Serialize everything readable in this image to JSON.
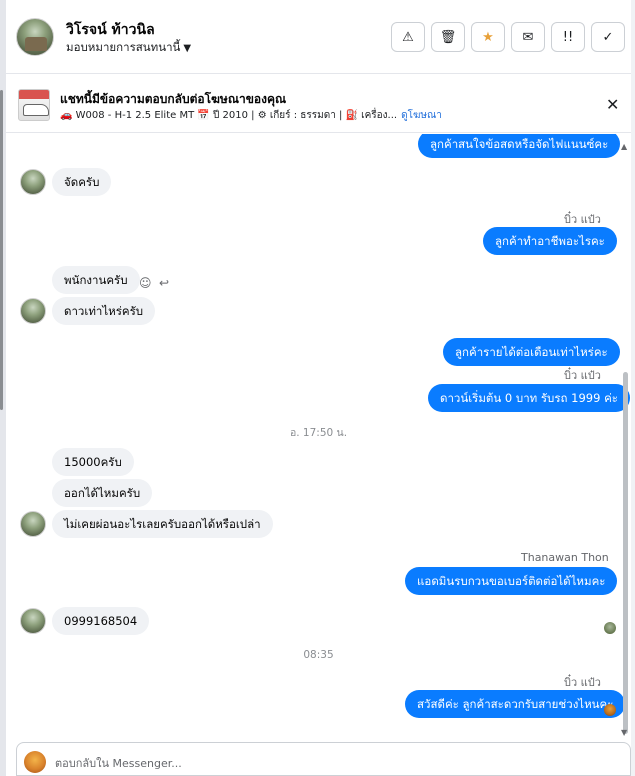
{
  "header": {
    "contact_name": "วิโรจน์ ท้าวนิล",
    "assign_label": "มอบหมายการสนทนานี้",
    "assign_caret": "▼",
    "actions": [
      {
        "name": "report",
        "glyph": "⚠"
      },
      {
        "name": "delete",
        "glyph": "🗑"
      },
      {
        "name": "star",
        "glyph": "★"
      },
      {
        "name": "mail",
        "glyph": "✉"
      },
      {
        "name": "urgent",
        "glyph": "!!"
      },
      {
        "name": "done",
        "glyph": "✓"
      }
    ]
  },
  "ad": {
    "title": "แชทนี้มีข้อความตอบกลับต่อโฆษณาของคุณ",
    "details": "🚗 W008 - H-1 2.5 Elite MT 📅 ปี 2010 | ⚙ เกียร์ : ธรรมดา | ⛽ เครื่อง...",
    "link": "ดูโฆษณา",
    "close": "✕"
  },
  "messages": {
    "m0": "ลูกค้าสนใจข้อสดหรือจัดไฟแนนซ์คะ",
    "m1": "จัดครับ",
    "s1": "บิ๋ว แป๋ว",
    "m2": "ลูกค้าทำอาชีพอะไรคะ",
    "m3": "พนักงานครับ",
    "m4": "ดาวเท่าไหร่ครับ",
    "m5": "ลูกค้ารายได้ต่อเดือนเท่าไหร่คะ",
    "s2": "บิ๋ว แป๋ว",
    "m6": "ดาวน์เริ่มต้น 0 บาท รับรถ 1999 ค่ะ",
    "t1": "อ. 17:50 น.",
    "m7": "15000ครับ",
    "m8": "ออกได้ไหมครับ",
    "m9": "ไม่เคยผ่อนอะไรเลยครับออกได้หรือเปล่า",
    "s3": "Thanawan Thon",
    "m10": "แอดมินรบกวนขอเบอร์ติดต่อได้ไหมคะ",
    "m11": "0999168504",
    "t2": "08:35",
    "s4": "บิ๋ว แป๋ว",
    "m12": "สวัสดีค่ะ ลูกค้าสะดวกรับสายช่วงไหนคะ"
  },
  "reactions": {
    "emoji": "☺",
    "reply": "↩"
  },
  "composer": {
    "placeholder": "ตอบกลับใน Messenger..."
  }
}
